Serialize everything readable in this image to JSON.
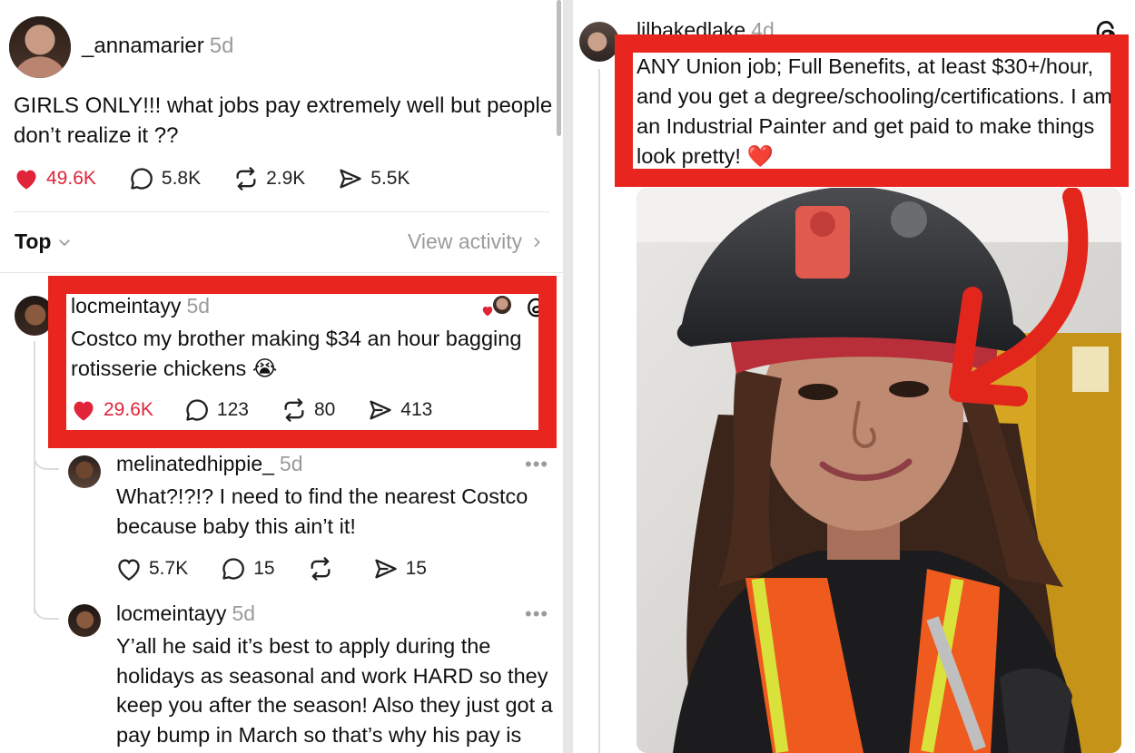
{
  "left": {
    "op": {
      "username": "_annamarier",
      "time": "5d",
      "text": "GIRLS ONLY!!! what jobs pay extremely well but people don’t realize it ??",
      "likes": "49.6K",
      "replies": "5.8K",
      "reposts": "2.9K",
      "shares": "5.5K"
    },
    "sort": {
      "label": "Top",
      "view_activity": "View activity"
    },
    "replies": [
      {
        "username": "locmeintayy",
        "time": "5d",
        "text": "Costco my brother making $34 an hour bagging rotisserie chickens 😭",
        "likes": "29.6K",
        "replies": "123",
        "reposts": "80",
        "shares": "413"
      },
      {
        "username": "melinatedhippie_",
        "time": "5d",
        "text": "What?!?!? I need to find the nearest Costco because baby this ain’t it!",
        "likes": "5.7K",
        "replies": "15",
        "reposts": "",
        "shares": "15",
        "more": "•••"
      },
      {
        "username": "locmeintayy",
        "time": "5d",
        "text": "Y’all he said it’s best to apply during the holidays as seasonal and work HARD so they keep you after the season! Also they just got a pay bump in March so that’s why his pay is",
        "more": "•••"
      }
    ]
  },
  "right": {
    "post": {
      "username": "lilbakedlake",
      "time": "4d",
      "text": "ANY Union job; Full Benefits, at least $30+/hour, and you get a degree/schooling/certifications. I am an Industrial Painter and get paid to make things look pretty! ❤️"
    }
  },
  "colors": {
    "highlight_red": "#e8261f",
    "like_red": "#e0243a",
    "muted": "#9b9b9b"
  },
  "icons": [
    "heart-icon",
    "comment-icon",
    "repost-icon",
    "share-icon",
    "chevron-down-icon",
    "chevron-right-icon",
    "threads-logo-icon",
    "more-icon",
    "arrow-icon"
  ]
}
